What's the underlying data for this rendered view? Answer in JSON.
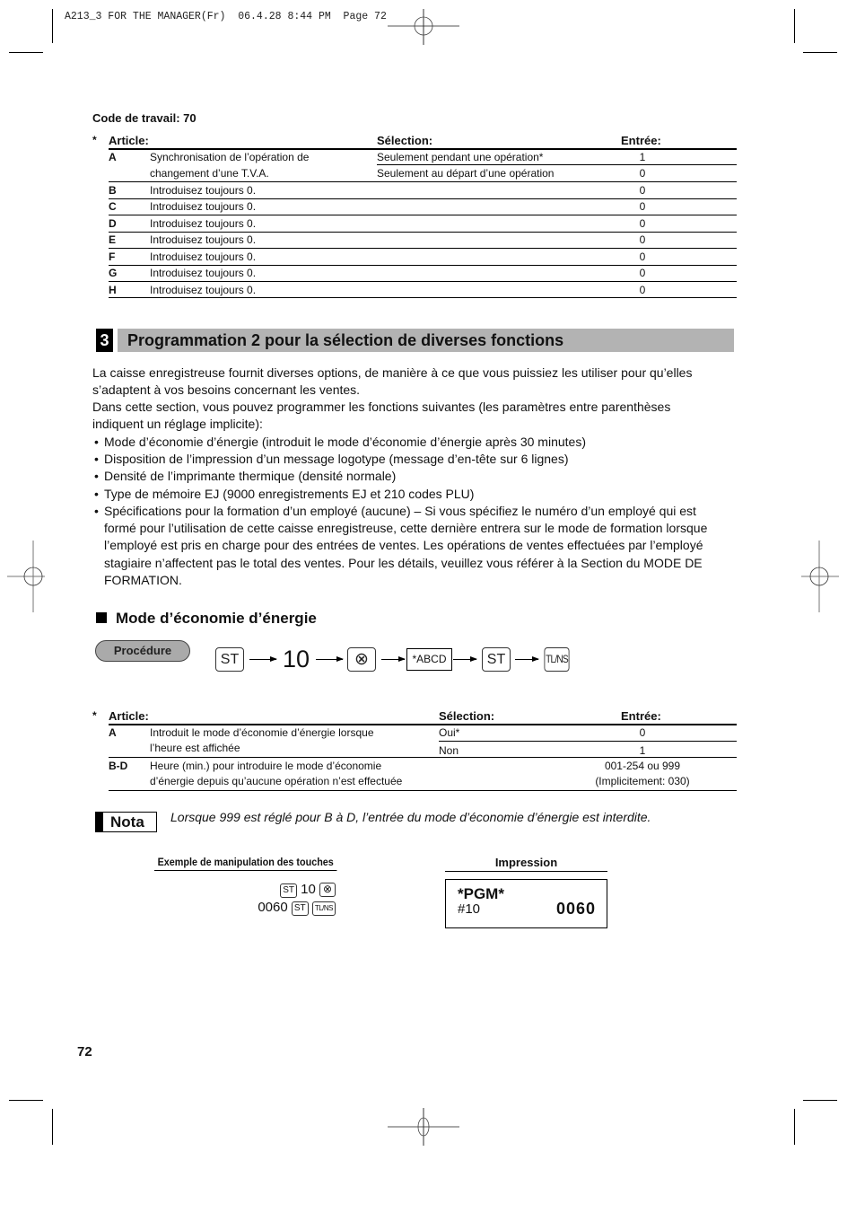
{
  "slug": {
    "text": "A213_3 FOR THE MANAGER(Fr)  06.4.28 8:44 PM  Page 72"
  },
  "job_code": {
    "title": "Code de travail: 70",
    "asterisk": "*",
    "headers": {
      "article": "Article:",
      "selection": "Sélection:",
      "entry": "Entrée:"
    },
    "rows": [
      {
        "label": "A",
        "desc_lines": [
          "Synchronisation de l’opération de",
          "changement d’une T.V.A."
        ],
        "options": [
          {
            "selection": "Seulement pendant une opération*",
            "entry": "1"
          },
          {
            "selection": "Seulement au départ d’une opération",
            "entry": "0"
          }
        ]
      },
      {
        "label": "B",
        "desc": "Introduisez toujours 0.",
        "entry": "0"
      },
      {
        "label": "C",
        "desc": "Introduisez toujours 0.",
        "entry": "0"
      },
      {
        "label": "D",
        "desc": "Introduisez toujours 0.",
        "entry": "0"
      },
      {
        "label": "E",
        "desc": "Introduisez toujours 0.",
        "entry": "0"
      },
      {
        "label": "F",
        "desc": "Introduisez toujours 0.",
        "entry": "0"
      },
      {
        "label": "G",
        "desc": "Introduisez toujours 0.",
        "entry": "0"
      },
      {
        "label": "H",
        "desc": "Introduisez toujours 0.",
        "entry": "0"
      }
    ]
  },
  "section": {
    "number": "3",
    "title": "Programmation 2 pour la sélection de diverses fonctions",
    "intro_lines": [
      "La caisse enregistreuse fournit diverses options, de manière à ce que vous puissiez les utiliser pour qu’elles",
      "s’adaptent à vos besoins concernant les ventes.",
      "Dans cette section, vous pouvez programmer les fonctions suivantes (les paramètres entre parenthèses",
      "indiquent un réglage implicite):"
    ],
    "bullets": [
      "Mode d’économie d’énergie (introduit le mode d’économie d’énergie après 30 minutes)",
      "Disposition de l’impression d’un message logotype (message d’en-tête sur 6 lignes)",
      "Densité de l’imprimante thermique (densité normale)",
      "Type de mémoire EJ (9000 enregistrements EJ et 210 codes PLU)",
      "Spécifications pour la formation d’un employé (aucune) – Si vous spécifiez le numéro d’un employé qui est formé pour l’utilisation de cette caisse enregistreuse, cette dernière entrera sur le mode de formation lorsque l’employé est pris en charge pour des entrées de ventes. Les opérations de ventes effectuées par l’employé stagiaire n’affectent pas le total des ventes. Pour les détails, veuillez vous référer à la Section du MODE DE FORMATION."
    ],
    "bullet_char": "•",
    "bullet5_lines": [
      "Spécifications pour la formation d’un employé (aucune) – Si vous spécifiez le numéro d’un employé qui est",
      "formé pour l’utilisation de cette caisse enregistreuse, cette dernière entrera sur le mode de formation lorsque",
      "l’employé est pris en charge pour des entrées de ventes. Les opérations de ventes effectuées par l’employé",
      "stagiaire n’affectent pas le total des ventes. Pour les détails, veuillez vous référer à la Section du MODE DE",
      "FORMATION."
    ]
  },
  "energy_saving": {
    "heading": "Mode d’économie d’énergie",
    "procedure_label": "Procédure",
    "procedure_steps": [
      {
        "type": "key",
        "label": "ST"
      },
      {
        "type": "number",
        "label": "10"
      },
      {
        "type": "key",
        "label": "⊗",
        "icon": "multiply-key-icon"
      },
      {
        "type": "box",
        "label": "*ABCD"
      },
      {
        "type": "key",
        "label": "ST"
      },
      {
        "type": "key",
        "label": "TL/NS"
      }
    ],
    "table": {
      "asterisk": "*",
      "headers": {
        "article": "Article:",
        "selection": "Sélection:",
        "entry": "Entrée:"
      },
      "rows": [
        {
          "label": "A",
          "desc_lines": [
            "Introduit le mode d’économie d’énergie lorsque",
            "l’heure est affichée"
          ],
          "options": [
            {
              "selection": "Oui*",
              "entry": "0"
            },
            {
              "selection": "Non",
              "entry": "1"
            }
          ]
        },
        {
          "label": "B-D",
          "desc_lines": [
            "Heure (min.) pour introduire le mode d’économie",
            "d’énergie depuis qu’aucune opération n’est effectuée"
          ],
          "entry_lines": [
            "001-254 ou 999",
            "(Implicitement: 030)"
          ]
        }
      ]
    },
    "note_label": "Nota",
    "note_text": "Lorsque 999 est réglé pour B à D, l’entrée du mode d’économie d’énergie est interdite.",
    "example": {
      "heading": "Exemple de manipulation des touches",
      "line1": {
        "key1": "ST",
        "number": "10",
        "key2": "⊗"
      },
      "line2": {
        "number": "0060",
        "key1": "ST",
        "key2": "TL/NS"
      }
    },
    "printout": {
      "heading": "Impression",
      "title": "*PGM*",
      "code": "#10",
      "value": "0060"
    }
  },
  "page_number": "72"
}
